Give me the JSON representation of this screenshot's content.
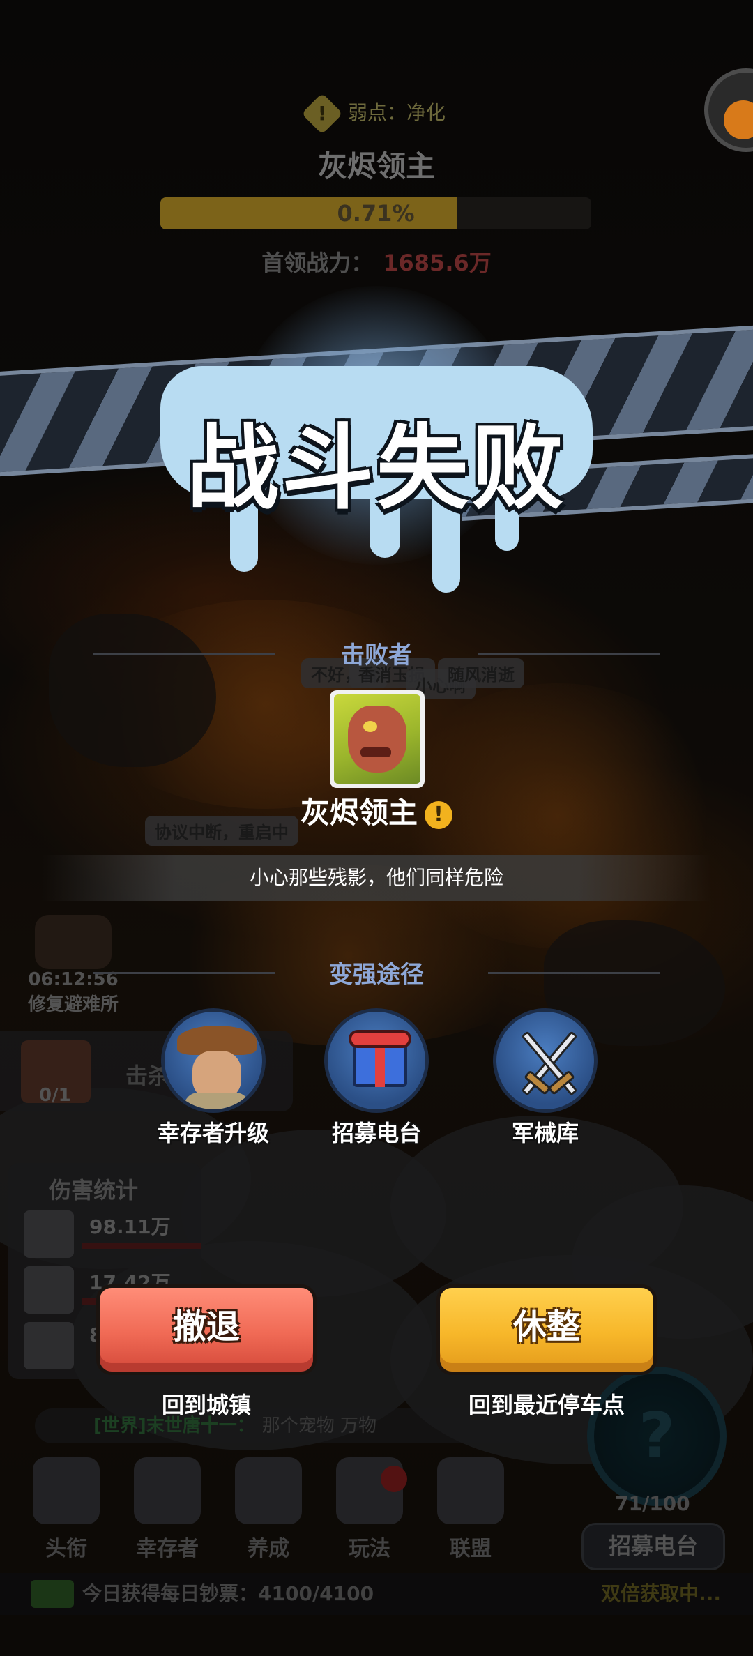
{
  "boss_header": {
    "weak_point": "弱点：净化",
    "warn_glyph": "!",
    "boss_name": "灰烬领主",
    "hp_text": "0.71%",
    "hp_fraction": 0.0071,
    "power_label": "首领战力：",
    "power_value": "1685.6万"
  },
  "banner": {
    "title": "战斗失败"
  },
  "killer_section": {
    "header": "击败者",
    "boss_name": "灰烬领主",
    "warn_glyph": "!",
    "tip": "小心那些残影，他们同样危险"
  },
  "strengthen_section": {
    "header": "变强途径",
    "options": [
      {
        "label": "幸存者升级",
        "icon": "survivor-cowboy-icon"
      },
      {
        "label": "招募电台",
        "icon": "gift-box-icon"
      },
      {
        "label": "军械库",
        "icon": "crossed-swords-icon"
      }
    ]
  },
  "buttons": {
    "retreat_label": "撤退",
    "retreat_caption": "回到城镇",
    "rest_label": "休整",
    "rest_caption": "回到最近停车点"
  },
  "background_hud": {
    "timer": "06:12:56",
    "timer_caption": "修复避难所",
    "bubble_1": "不好，看",
    "bubble_2": "香消玉损",
    "bubble_3": "小心啊",
    "bubble_4": "随风消逝",
    "bubble_5": "协议中断，重启中",
    "task_count": "0/1",
    "task_label": "击杀",
    "damage_title": "伤害统计",
    "damage_rows": [
      "98.11万",
      "17.42万",
      "8"
    ],
    "chat_channel": "[世界]末世唐十一：",
    "chat_text": "那个宠物 万物",
    "recruit_count": "71/100",
    "recruit_button": "招募电台",
    "radar_glyph": "?",
    "nav": [
      "头衔",
      "幸存者",
      "养成",
      "玩法",
      "联盟"
    ],
    "daily_label": "今日获得每日钞票：4100/4100",
    "double_label": "双倍获取中..."
  },
  "colors": {
    "retreat_button": "#f06a55",
    "rest_button": "#f7b72a",
    "section_header": "#8ea8d8",
    "banner_splat": "#b8dcf2"
  }
}
